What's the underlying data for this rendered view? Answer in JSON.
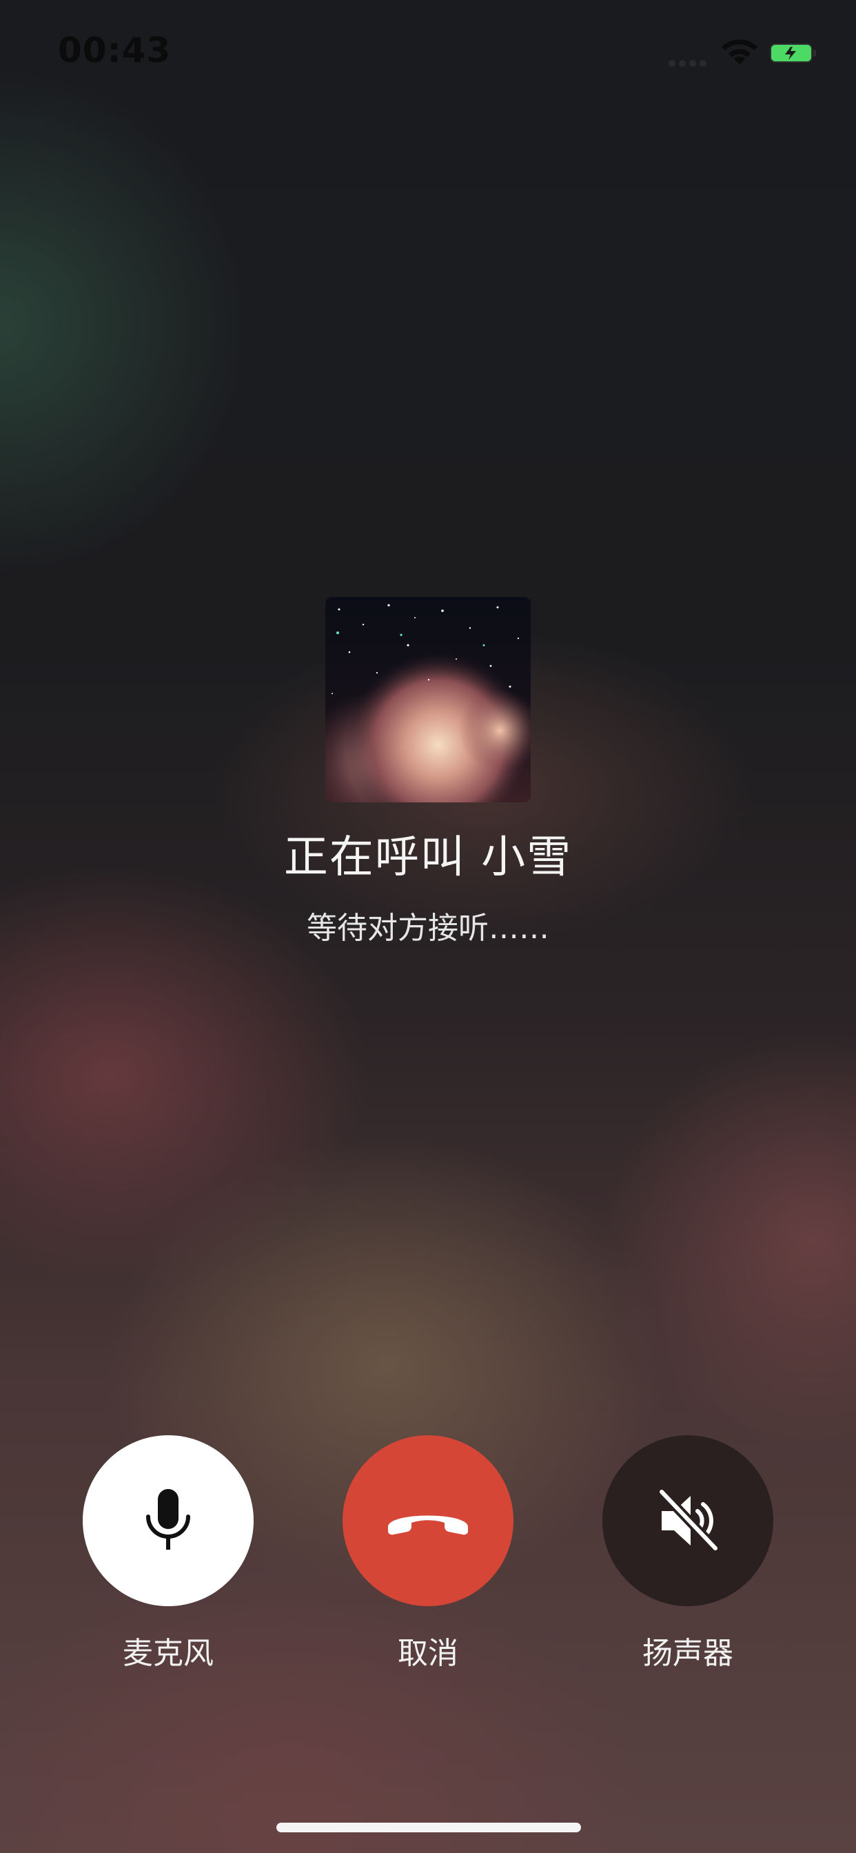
{
  "status_bar": {
    "time": "00:43",
    "signal_icon": "cellular-signal-icon",
    "wifi_icon": "wifi-icon",
    "battery_icon": "battery-charging-icon",
    "battery_color": "#4cd964"
  },
  "call": {
    "avatar_icon": "nebula-avatar-image",
    "title": "正在呼叫 小雪",
    "status": "等待对方接听……"
  },
  "controls": [
    {
      "label": "麦克风",
      "icon": "microphone-icon",
      "color": "#ffffff"
    },
    {
      "label": "取消",
      "icon": "hang-up-icon",
      "color": "#d54637"
    },
    {
      "label": "扬声器",
      "icon": "speaker-muted-icon",
      "color": "#2b2020"
    }
  ]
}
